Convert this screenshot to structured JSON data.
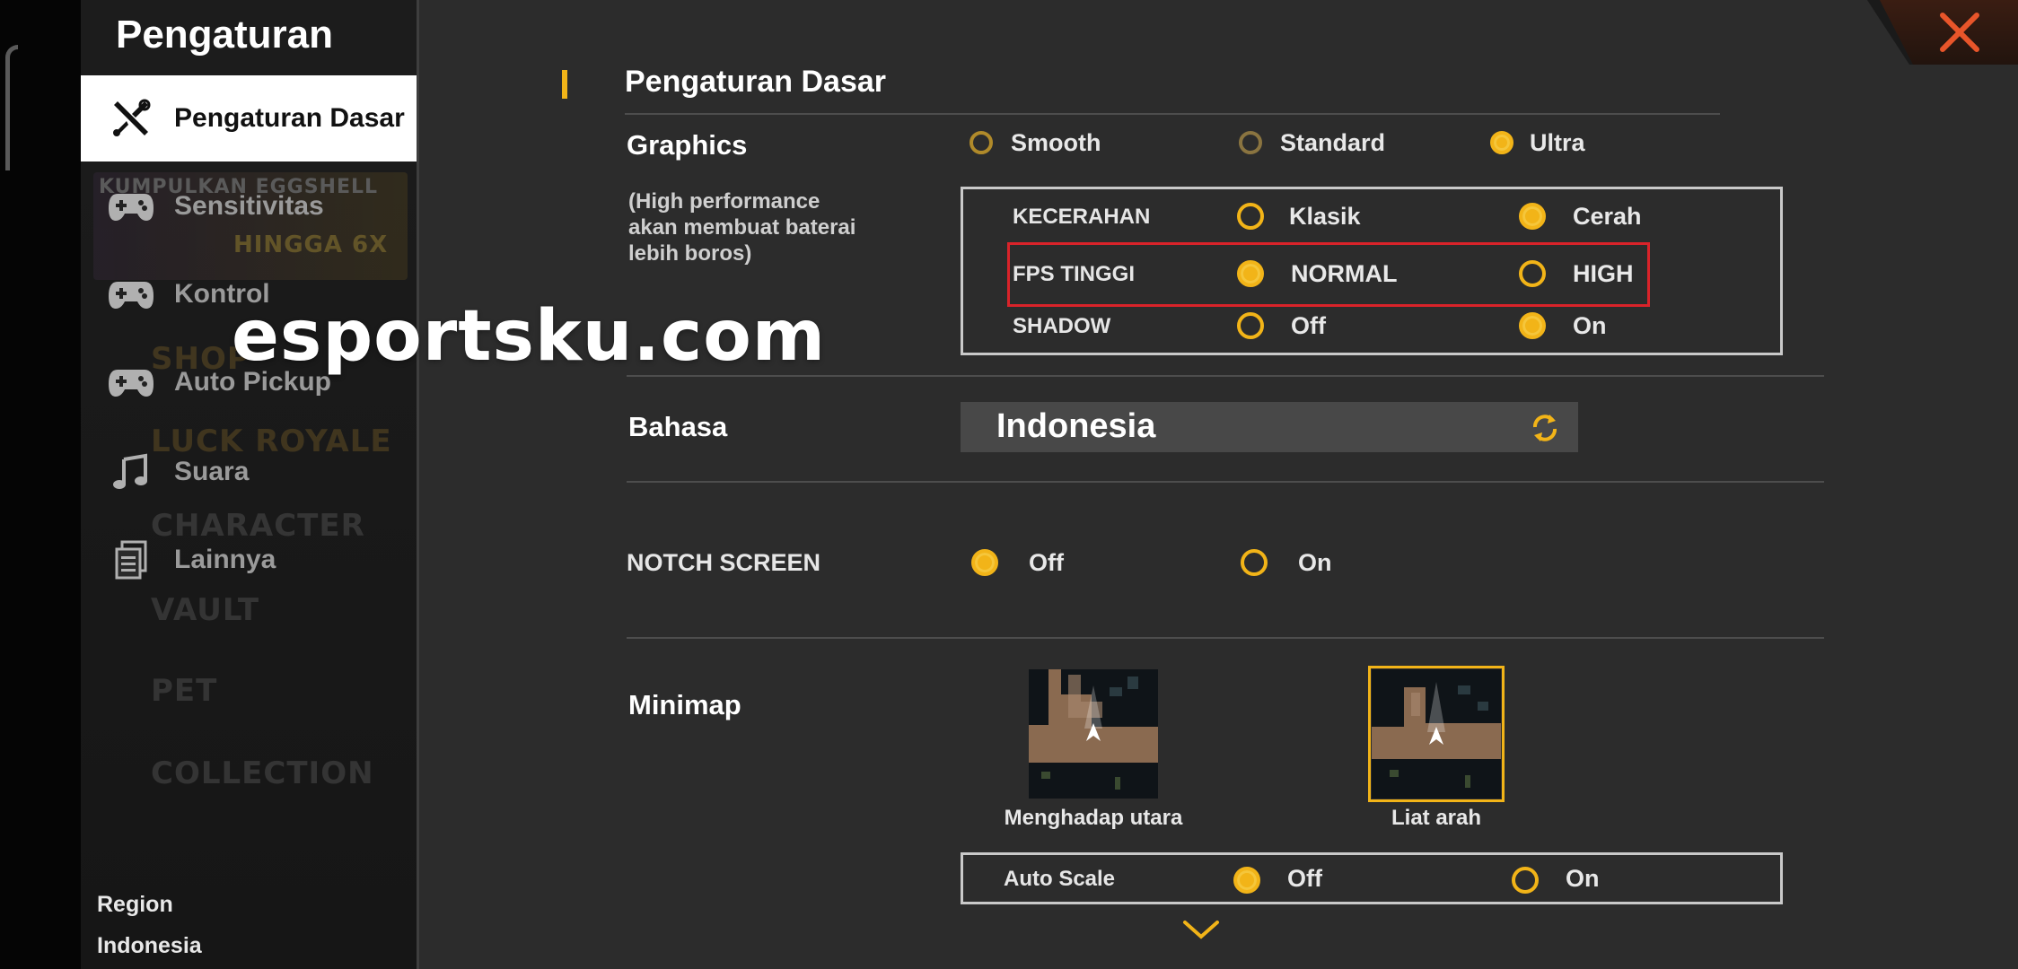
{
  "sidebar": {
    "title": "Pengaturan",
    "items": [
      {
        "label": "Pengaturan Dasar",
        "icon": "tools-icon",
        "active": true
      },
      {
        "label": "Sensitivitas",
        "icon": "gamepad-icon"
      },
      {
        "label": "Kontrol",
        "icon": "gamepad-icon"
      },
      {
        "label": "Auto Pickup",
        "icon": "gamepad-icon"
      },
      {
        "label": "Suara",
        "icon": "music-note-icon"
      },
      {
        "label": "Lainnya",
        "icon": "document-icon"
      }
    ],
    "background_text": [
      "KUMPULKAN EGGSHELL",
      "HINGGA 6X",
      "SHOP",
      "LUCK ROYALE",
      "CHARACTER",
      "VAULT",
      "PET",
      "COLLECTION"
    ],
    "region_label": "Region",
    "region_value": "Indonesia"
  },
  "main": {
    "section_title": "Pengaturan Dasar",
    "graphics": {
      "label": "Graphics",
      "note": "(High performance akan membuat baterai lebih boros)",
      "options": [
        "Smooth",
        "Standard",
        "Ultra"
      ],
      "selected": "Ultra"
    },
    "sub_settings": [
      {
        "label": "KECERAHAN",
        "options": [
          "Klasik",
          "Cerah"
        ],
        "selected": "Cerah"
      },
      {
        "label": "FPS TINGGI",
        "options": [
          "NORMAL",
          "HIGH"
        ],
        "selected": "NORMAL",
        "highlighted": true
      },
      {
        "label": "SHADOW",
        "options": [
          "Off",
          "On"
        ],
        "selected": "On"
      }
    ],
    "bahasa": {
      "label": "Bahasa",
      "value": "Indonesia"
    },
    "notch": {
      "label": "NOTCH SCREEN",
      "options": [
        "Off",
        "On"
      ],
      "selected": "Off"
    },
    "minimap": {
      "label": "Minimap",
      "options": [
        {
          "caption": "Menghadap utara",
          "selected": false
        },
        {
          "caption": "Liat arah",
          "selected": true
        }
      ]
    },
    "auto_scale": {
      "label": "Auto Scale",
      "options": [
        "Off",
        "On"
      ],
      "selected": "Off"
    }
  },
  "watermark": "esportsku.com",
  "colors": {
    "accent": "#f2b418",
    "highlight": "#d9232a",
    "close": "#e8552a"
  }
}
